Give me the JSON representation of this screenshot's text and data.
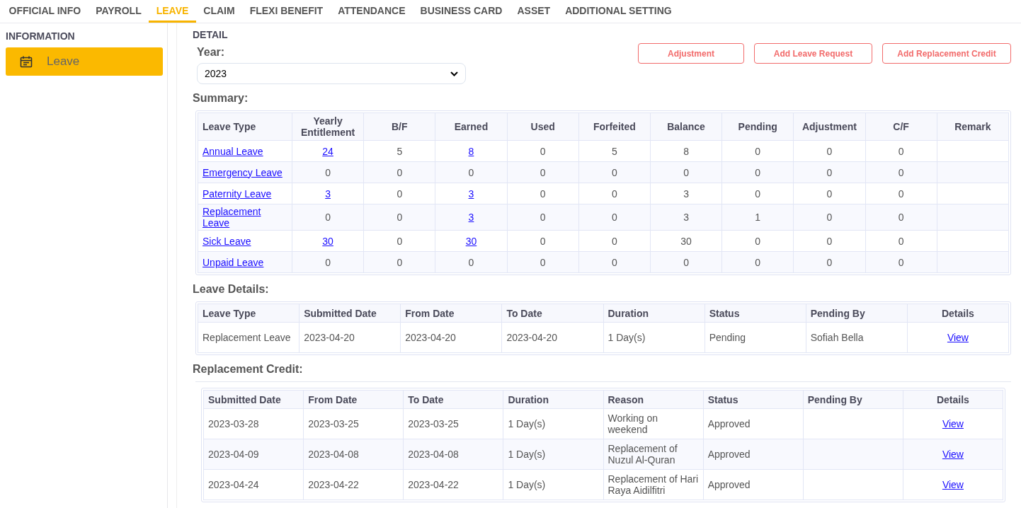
{
  "tabs": [
    {
      "label": "OFFICIAL INFO",
      "selected": false
    },
    {
      "label": "PAYROLL",
      "selected": false
    },
    {
      "label": "LEAVE",
      "selected": true
    },
    {
      "label": "CLAIM",
      "selected": false
    },
    {
      "label": "FLEXI BENEFIT",
      "selected": false
    },
    {
      "label": "ATTENDANCE",
      "selected": false
    },
    {
      "label": "BUSINESS CARD",
      "selected": false
    },
    {
      "label": "ASSET",
      "selected": false
    },
    {
      "label": "ADDITIONAL SETTING",
      "selected": false
    }
  ],
  "sidebar": {
    "title": "INFORMATION",
    "items": [
      {
        "label": "Leave",
        "selected": true
      }
    ]
  },
  "detail": {
    "title": "DETAIL",
    "year_label": "Year:",
    "year": "2023",
    "buttons": [
      "Adjustment",
      "Add Leave Request",
      "Add Replacement Credit"
    ],
    "summary": {
      "title": "Summary:",
      "columns": [
        "Leave Type",
        "Yearly Entitlement",
        "B/F",
        "Earned",
        "Used",
        "Forfeited",
        "Balance",
        "Pending",
        "Adjustment",
        "C/F",
        "Remark"
      ],
      "rows": [
        [
          {
            "text": "Annual Leave",
            "link": true
          },
          {
            "text": "24",
            "link": true
          },
          {
            "text": "5",
            "link": false
          },
          {
            "text": "8",
            "link": true
          },
          {
            "text": "0",
            "link": false
          },
          {
            "text": "5",
            "link": false
          },
          {
            "text": "8",
            "link": false
          },
          {
            "text": "0",
            "link": false
          },
          {
            "text": "0",
            "link": false
          },
          {
            "text": "0",
            "link": false
          }
        ],
        [
          {
            "text": "Emergency Leave",
            "link": true
          },
          {
            "text": "0",
            "link": false
          },
          {
            "text": "0",
            "link": false
          },
          {
            "text": "0",
            "link": false
          },
          {
            "text": "0",
            "link": false
          },
          {
            "text": "0",
            "link": false
          },
          {
            "text": "0",
            "link": false
          },
          {
            "text": "0",
            "link": false
          },
          {
            "text": "0",
            "link": false
          },
          {
            "text": "0",
            "link": false
          }
        ],
        [
          {
            "text": "Paternity Leave",
            "link": true
          },
          {
            "text": "3",
            "link": true
          },
          {
            "text": "0",
            "link": false
          },
          {
            "text": "3",
            "link": true
          },
          {
            "text": "0",
            "link": false
          },
          {
            "text": "0",
            "link": false
          },
          {
            "text": "3",
            "link": false
          },
          {
            "text": "0",
            "link": false
          },
          {
            "text": "0",
            "link": false
          },
          {
            "text": "0",
            "link": false
          }
        ],
        [
          {
            "text": "Replacement Leave",
            "link": true
          },
          {
            "text": "0",
            "link": false
          },
          {
            "text": "0",
            "link": false
          },
          {
            "text": "3",
            "link": true
          },
          {
            "text": "0",
            "link": false
          },
          {
            "text": "0",
            "link": false
          },
          {
            "text": "3",
            "link": false
          },
          {
            "text": "1",
            "link": false
          },
          {
            "text": "0",
            "link": false
          },
          {
            "text": "0",
            "link": false
          }
        ],
        [
          {
            "text": "Sick Leave",
            "link": true
          },
          {
            "text": "30",
            "link": true
          },
          {
            "text": "0",
            "link": false
          },
          {
            "text": "30",
            "link": true
          },
          {
            "text": "0",
            "link": false
          },
          {
            "text": "0",
            "link": false
          },
          {
            "text": "30",
            "link": false
          },
          {
            "text": "0",
            "link": false
          },
          {
            "text": "0",
            "link": false
          },
          {
            "text": "0",
            "link": false
          }
        ],
        [
          {
            "text": "Unpaid Leave",
            "link": true
          },
          {
            "text": "0",
            "link": false
          },
          {
            "text": "0",
            "link": false
          },
          {
            "text": "0",
            "link": false
          },
          {
            "text": "0",
            "link": false
          },
          {
            "text": "0",
            "link": false
          },
          {
            "text": "0",
            "link": false
          },
          {
            "text": "0",
            "link": false
          },
          {
            "text": "0",
            "link": false
          },
          {
            "text": "0",
            "link": false
          }
        ]
      ]
    },
    "leave_details": {
      "title": "Leave Details:",
      "columns": [
        "Leave Type",
        "Submitted Date",
        "From Date",
        "To Date",
        "Duration",
        "Status",
        "Pending By",
        "Details"
      ],
      "rows": [
        {
          "cells": [
            "Replacement Leave",
            "2023-04-20",
            "2023-04-20",
            "2023-04-20",
            "1 Day(s)",
            "Pending",
            "Sofiah Bella"
          ],
          "details": "View"
        }
      ]
    },
    "replacement_credit": {
      "title": "Replacement Credit:",
      "columns": [
        "Submitted Date",
        "From Date",
        "To Date",
        "Duration",
        "Reason",
        "Status",
        "Pending By",
        "Details"
      ],
      "rows": [
        {
          "cells": [
            "2023-03-28",
            "2023-03-25",
            "2023-03-25",
            "1 Day(s)",
            "Working on weekend",
            "Approved",
            ""
          ],
          "details": "View"
        },
        {
          "cells": [
            "2023-04-09",
            "2023-04-08",
            "2023-04-08",
            "1 Day(s)",
            "Replacement of Nuzul Al-Quran",
            "Approved",
            ""
          ],
          "details": "View"
        },
        {
          "cells": [
            "2023-04-24",
            "2023-04-22",
            "2023-04-22",
            "1 Day(s)",
            "Replacement of Hari Raya Aidilfitri",
            "Approved",
            ""
          ],
          "details": "View"
        }
      ]
    }
  }
}
